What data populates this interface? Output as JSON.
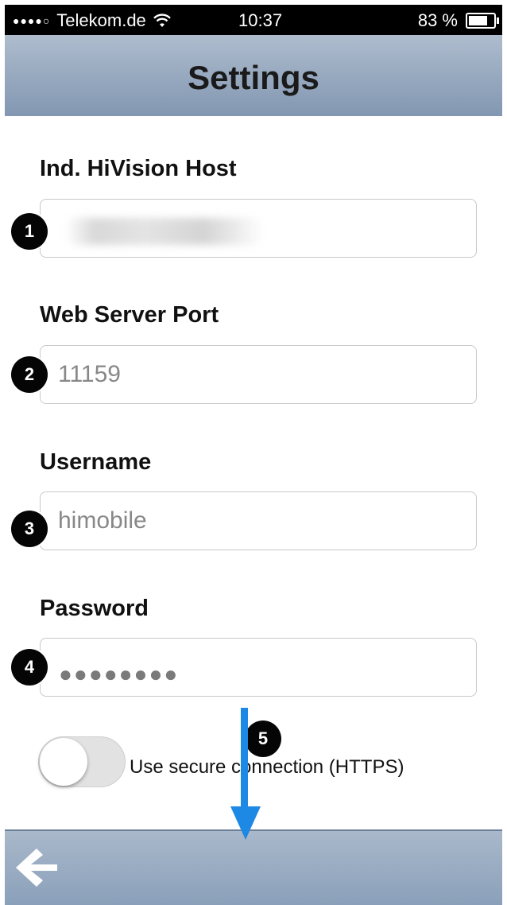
{
  "status_bar": {
    "signal": "●●●●○",
    "carrier": "Telekom.de",
    "time": "10:37",
    "battery_text": "83 %",
    "battery_level": 0.83
  },
  "header": {
    "title": "Settings"
  },
  "form": {
    "host_label": "Ind. HiVision Host",
    "host_value": "",
    "port_label": "Web Server Port",
    "port_value": "11159",
    "username_label": "Username",
    "username_value": "himobile",
    "password_label": "Password",
    "password_mask": "●●●●●●●●",
    "https_label": "Use secure connection (HTTPS)",
    "https_enabled": false
  },
  "callouts": {
    "one": "1",
    "two": "2",
    "three": "3",
    "four": "4",
    "five": "5"
  },
  "colors": {
    "header": "#8297b2",
    "annotation_arrow": "#1e88e5"
  },
  "icons": {
    "back": "arrow-left-icon",
    "wifi": "wifi-icon",
    "battery": "battery-icon"
  }
}
